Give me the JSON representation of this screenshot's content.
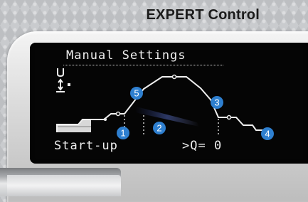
{
  "header": {
    "title": "EXPERT Control"
  },
  "screen": {
    "title": "Manual Settings",
    "status_left": "Start-up",
    "status_right": ">Q= 0",
    "icon": "voltage-adjust-icon"
  },
  "markers": [
    {
      "label": "1"
    },
    {
      "label": "2"
    },
    {
      "label": "3"
    },
    {
      "label": "4"
    },
    {
      "label": "5"
    }
  ],
  "colors": {
    "marker_blue": "#2e7fcf",
    "oled_text": "#efefef",
    "screen_bg": "#050505",
    "title_text": "#1b1b1b"
  }
}
